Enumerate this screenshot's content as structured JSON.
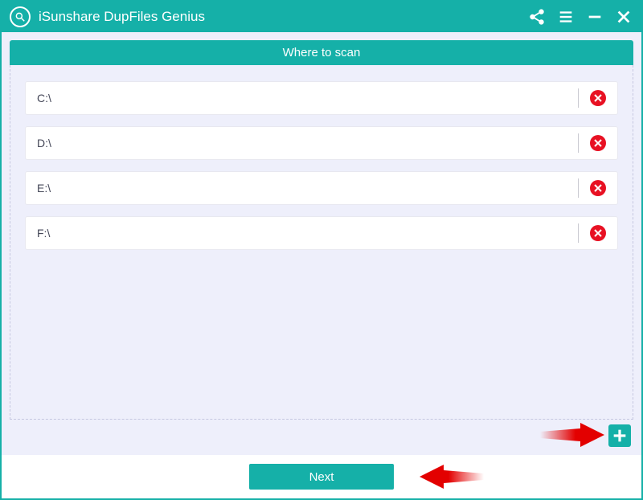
{
  "app": {
    "title": "iSunshare DupFiles Genius"
  },
  "section": {
    "header": "Where to scan"
  },
  "paths": [
    "C:\\",
    "D:\\",
    "E:\\",
    "F:\\"
  ],
  "footer": {
    "next_label": "Next"
  }
}
